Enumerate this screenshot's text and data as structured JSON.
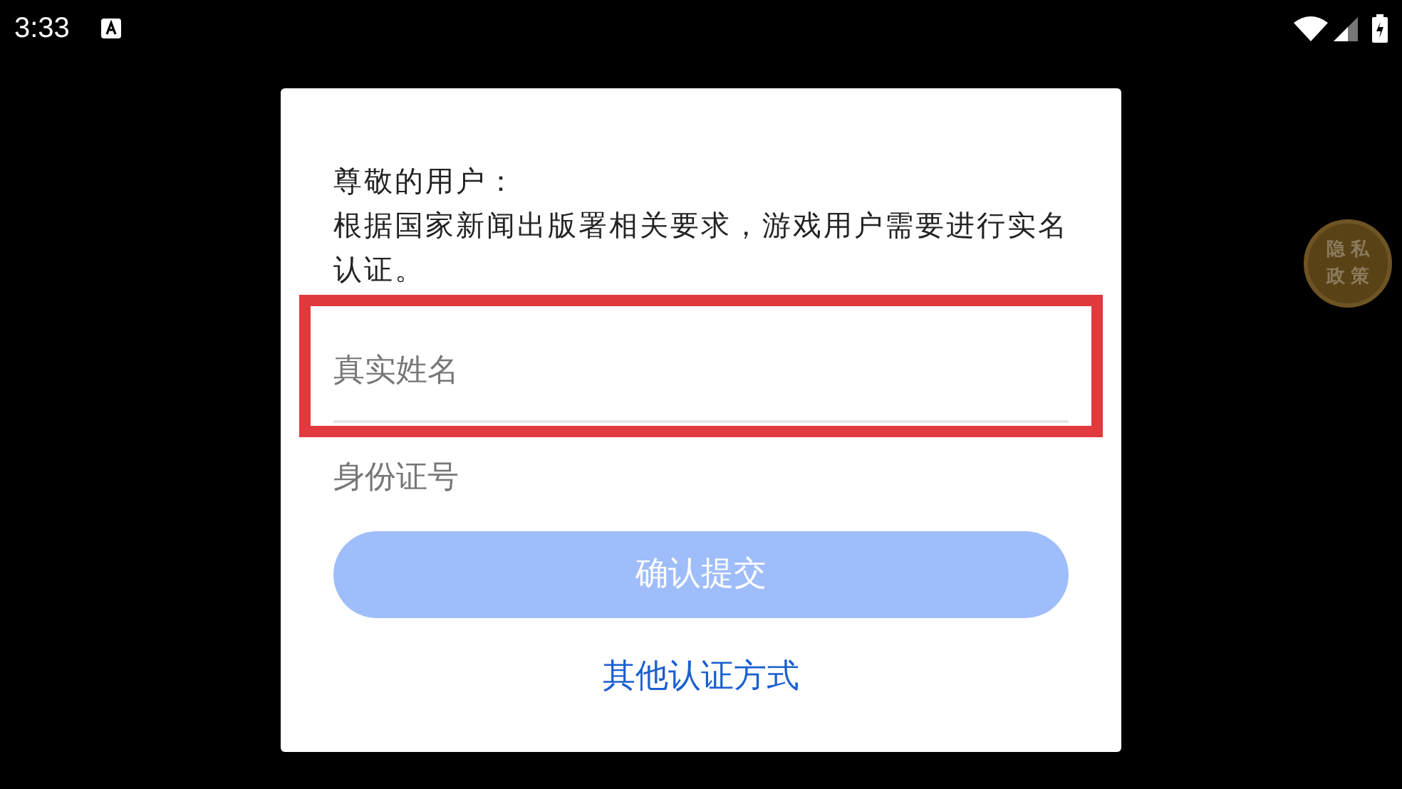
{
  "status_bar": {
    "time": "3:33"
  },
  "dialog": {
    "greeting": "尊敬的用户：",
    "message": "根据国家新闻出版署相关要求，游戏用户需要进行实名认证。",
    "fields": [
      {
        "placeholder": "真实姓名",
        "highlighted": true
      },
      {
        "placeholder": "身份证号",
        "highlighted": false
      }
    ],
    "submit_button": {
      "label": "确认提交",
      "disabled": true
    },
    "link": "其他认证方式"
  },
  "privacy_badge": {
    "lines": [
      "隐私",
      "政策"
    ]
  }
}
